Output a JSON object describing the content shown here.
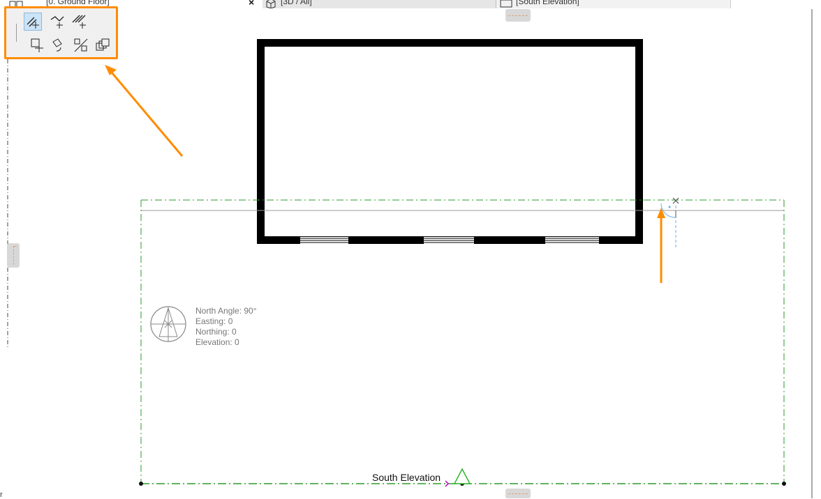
{
  "tabs": [
    {
      "label": "[0. Ground Floor]",
      "icon": "floor-plan-icon"
    },
    {
      "label": "[3D / All]",
      "icon": "3d-cube-icon"
    },
    {
      "label": "[South Elevation]",
      "icon": "elevation-icon"
    }
  ],
  "tab_close_label": "×",
  "toolbar": {
    "row1": [
      "offset-edge-icon",
      "offset-all-edges-icon",
      "multiple-offset-icon"
    ],
    "row2": [
      "drag-icon",
      "rotate-icon",
      "mirror-icon",
      "multiply-icon"
    ],
    "active": "offset-edge-icon"
  },
  "survey_point": {
    "north_angle": "North Angle: 90°",
    "easting": "Easting: 0",
    "northing": "Northing: 0",
    "elevation": "Elevation: 0"
  },
  "elevation_marker": {
    "label": "South Elevation"
  },
  "corner_text": "r",
  "colors": {
    "annotation": "#ff8c00",
    "elevation_line": "#2e9a2e",
    "selection": "#cce4f7",
    "marker": "#2db82d"
  }
}
